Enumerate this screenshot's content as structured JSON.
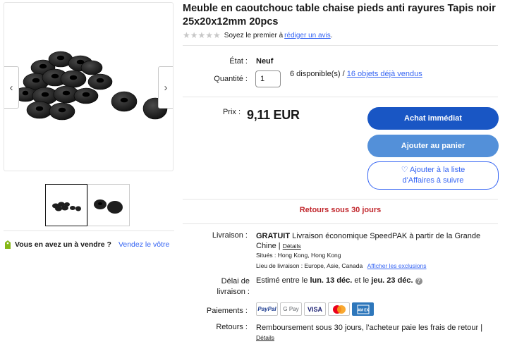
{
  "product": {
    "title": "Meuble en caoutchouc table chaise pieds anti rayures Tapis noir 25x20x12mm 20pcs",
    "rating_text": "Soyez le premier à",
    "rating_link": "rédiger un avis",
    "rating_suffix": "."
  },
  "gallery": {
    "prev_arrow": "‹",
    "next_arrow": "›"
  },
  "sell": {
    "question": "Vous en avez un à vendre ?",
    "link": "Vendez le vôtre"
  },
  "details": {
    "state_label": "État :",
    "state_value": "Neuf",
    "qty_label": "Quantité :",
    "qty_value": "1",
    "available": "6 disponible(s) /",
    "sold_link": "16 objets déjà vendus",
    "price_label": "Prix :",
    "price": "9,11 EUR"
  },
  "buttons": {
    "buy": "Achat immédiat",
    "cart": "Ajouter au panier",
    "watch_line1": "♡ Ajouter à la liste",
    "watch_line2": "d'Affaires à suivre"
  },
  "returns_banner": "Retours sous 30 jours",
  "shipping": {
    "label": "Livraison :",
    "free": "GRATUIT",
    "desc_line1": "Livraison économique SpeedPAK à partir de la Grande",
    "desc_line2": "Chine |",
    "details_link": "Détails",
    "location": "Situés : Hong Kong, Hong Kong",
    "ship_to": "Lieu de livraison : Europe, Asie, Canada",
    "exclusions_link": "Afficher les exclusions"
  },
  "delivery": {
    "label_line1": "Délai de",
    "label_line2": "livraison :",
    "prefix": "Estimé entre le",
    "date_from": "lun. 13 déc.",
    "middle": "et le",
    "date_to": "jeu. 23 déc.",
    "info_icon": "?"
  },
  "payments": {
    "label": "Paiements :",
    "methods": [
      "PayPal",
      "G Pay",
      "VISA",
      "mastercard",
      "AMERICAN EXPRESS"
    ]
  },
  "returns": {
    "label": "Retours :",
    "text": "Remboursement sous 30 jours, l'acheteur paie les frais de retour |",
    "details_link": "Détails"
  },
  "colors": {
    "primary": "#1956c4",
    "secondary": "#5390d9",
    "link": "#3665f3",
    "returns": "#c1272d"
  }
}
